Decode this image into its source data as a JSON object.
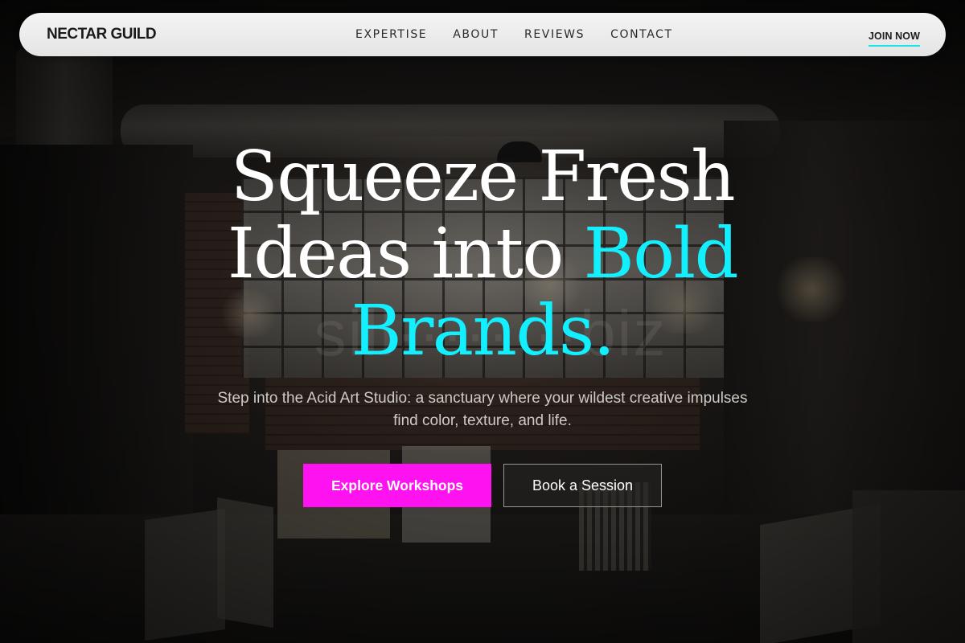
{
  "brand": {
    "name": "NECTAR GUILD"
  },
  "nav": {
    "links": [
      {
        "label": "EXPERTISE"
      },
      {
        "label": "ABOUT"
      },
      {
        "label": "REVIEWS"
      },
      {
        "label": "CONTACT"
      }
    ],
    "cta_label": "JOIN NOW"
  },
  "hero": {
    "headline_part1": "Squeeze Fresh Ideas into ",
    "headline_accent": "Bold Brands.",
    "subtitle": "Step into the Acid Art Studio: a sanctuary where your wildest creative impulses find color, texture, and life.",
    "primary_button": "Explore Workshops",
    "secondary_button": "Book a Session",
    "watermark": "sill········biz"
  },
  "colors": {
    "accent_cyan": "#12f0ff",
    "accent_magenta": "#ff12f0",
    "nav_background": "#eeeeee",
    "text_light": "#ffffff"
  },
  "icons": {
    "background": "studio-interior-photo"
  }
}
